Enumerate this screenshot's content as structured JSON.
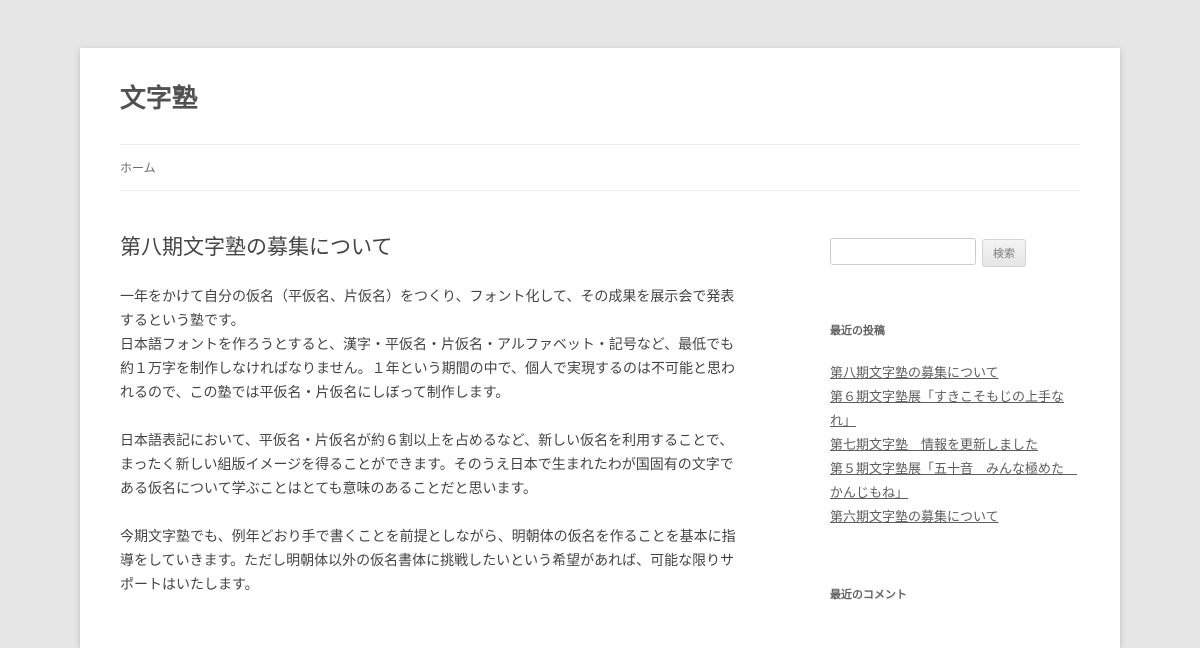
{
  "site": {
    "title": "文字塾"
  },
  "nav": {
    "items": [
      {
        "label": "ホーム"
      }
    ]
  },
  "post": {
    "title": "第八期文字塾の募集について",
    "paragraphs": [
      {
        "lines": [
          "一年をかけて自分の仮名（平仮名、片仮名）をつくり、フォント化して、その成果を展示会で発表",
          "するという塾です。",
          "日本語フォントを作ろうとすると、漢字・平仮名・片仮名・アルファベット・記号など、最低でも",
          "約１万字を制作しなければなりません。１年という期間の中で、個人で実現するのは不可能と思わ",
          "れるので、この塾では平仮名・片仮名にしぼって制作します。"
        ]
      },
      {
        "lines": [
          "日本語表記において、平仮名・片仮名が約６割以上を占めるなど、新しい仮名を利用することで、",
          "まったく新しい組版イメージを得ることができます。そのうえ日本で生まれたわが国固有の文字で",
          "ある仮名について学ぶことはとても意味のあることだと思います。"
        ]
      },
      {
        "lines": [
          "今期文字塾でも、例年どおり手で書くことを前提としながら、明朝体の仮名を作ることを基本に指",
          "導をしていきます。ただし明朝体以外の仮名書体に挑戦したいという希望があれば、可能な限りサ",
          "ポートはいたします。"
        ]
      }
    ]
  },
  "sidebar": {
    "search": {
      "placeholder": "",
      "button_label": "検索"
    },
    "recent_posts": {
      "title": "最近の投稿",
      "items": [
        "第八期文字塾の募集について",
        "第６期文字塾展「すきこそもじの上手なれ」",
        "第七期文字塾　情報を更新しました",
        "第５期文字塾展「五十音　みんな極めた　かんじもね」",
        "第六期文字塾の募集について"
      ]
    },
    "recent_comments": {
      "title": "最近のコメント"
    }
  }
}
